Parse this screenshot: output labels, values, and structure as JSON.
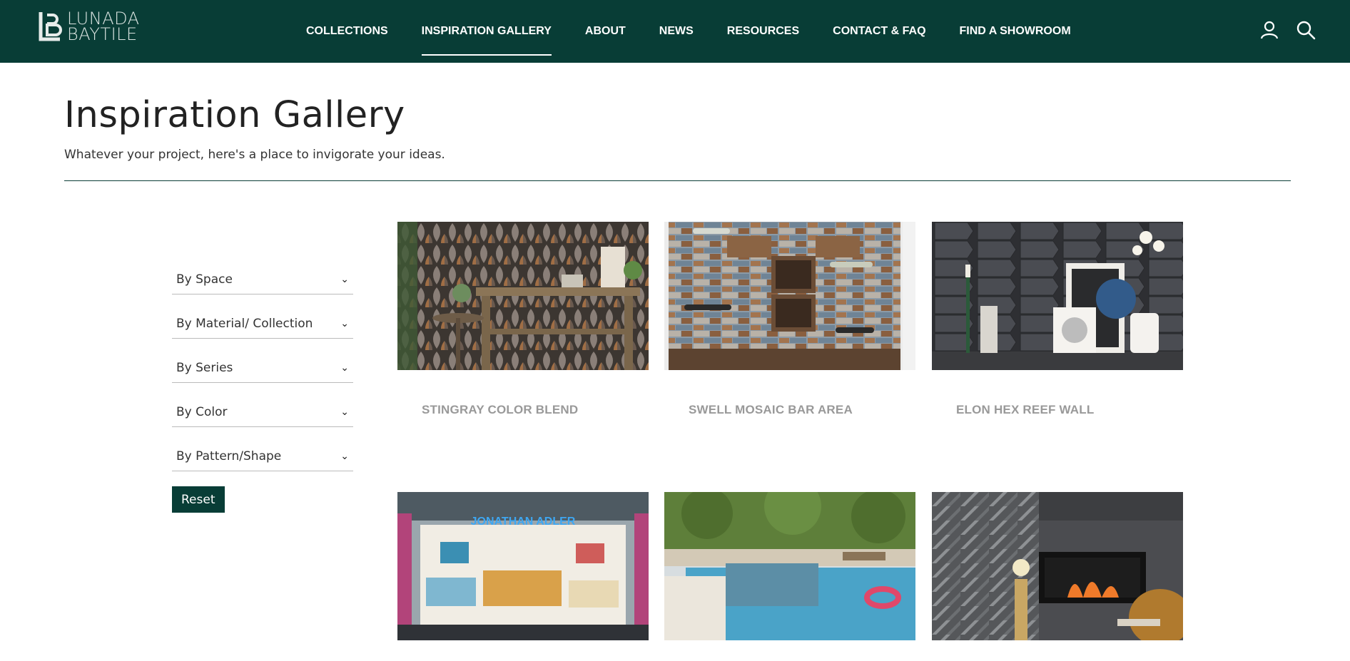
{
  "brand": {
    "line1": "LUNADA",
    "line2": "BAYTILE"
  },
  "nav": [
    {
      "label": "COLLECTIONS",
      "active": false
    },
    {
      "label": "INSPIRATION GALLERY",
      "active": true
    },
    {
      "label": "ABOUT",
      "active": false
    },
    {
      "label": "NEWS",
      "active": false
    },
    {
      "label": "RESOURCES",
      "active": false
    },
    {
      "label": "CONTACT & FAQ",
      "active": false
    },
    {
      "label": "FIND A SHOWROOM",
      "active": false
    }
  ],
  "header_icons": [
    "user-icon",
    "search-icon"
  ],
  "page": {
    "title": "Inspiration Gallery",
    "subtitle": "Whatever your project, here's a place to invigorate your ideas."
  },
  "filters": [
    "By Space",
    "By Material/ Collection",
    "By Series",
    "By Color",
    "By Pattern/Shape"
  ],
  "reset_label": "Reset",
  "gallery": [
    {
      "title": "STINGRAY COLOR BLEND"
    },
    {
      "title": "SWELL MOSAIC BAR AREA"
    },
    {
      "title": "ELON HEX REEF WALL"
    },
    {
      "title": "",
      "sign_text": "JONATHAN ADLER"
    },
    {
      "title": ""
    },
    {
      "title": ""
    }
  ],
  "colors": {
    "brand_green": "#083d36",
    "title_gray": "#999999"
  }
}
